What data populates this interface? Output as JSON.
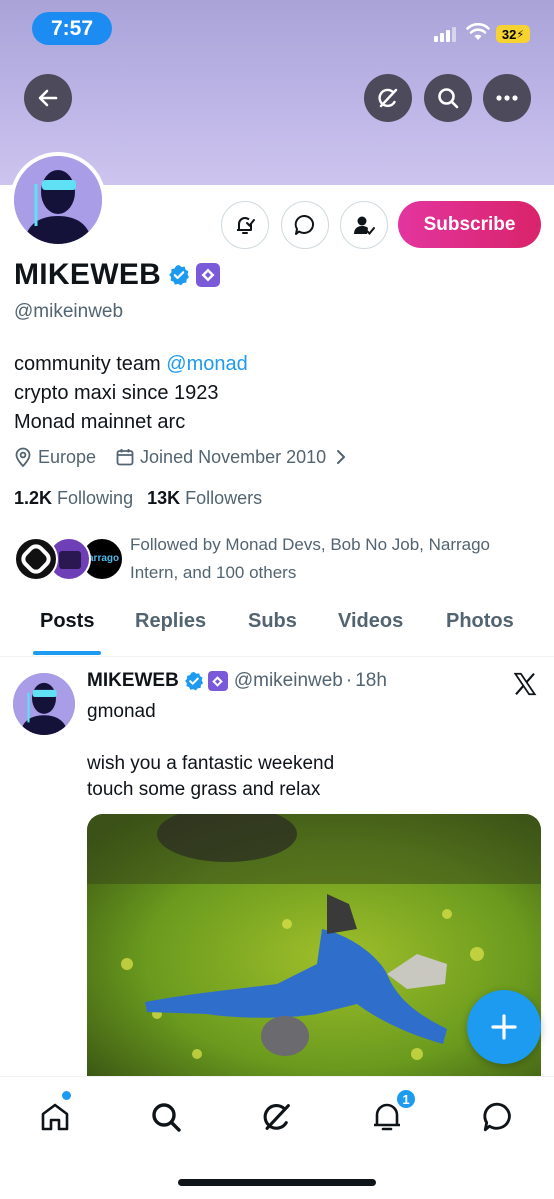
{
  "status_bar": {
    "time": "7:57",
    "battery": "32"
  },
  "profile": {
    "display_name": "MIKEWEB",
    "handle": "@mikeinweb",
    "subscribe_label": "Subscribe",
    "bio_line1_prefix": "community team ",
    "bio_mention": "@monad",
    "bio_line2": "crypto maxi since 1923",
    "bio_line3": "Monad mainnet arc",
    "location": "Europe",
    "joined": "Joined November 2010",
    "following_count": "1.2K",
    "following_label": "Following",
    "followers_count": "13K",
    "followers_label": "Followers",
    "followed_by": "Followed by Monad Devs, Bob No Job, Narrago Intern, and 100 others",
    "followed_avatar_3_text": "arrago"
  },
  "tabs": [
    {
      "label": "Posts",
      "active": true
    },
    {
      "label": "Replies"
    },
    {
      "label": "Subs"
    },
    {
      "label": "Videos"
    },
    {
      "label": "Photos"
    }
  ],
  "post": {
    "author": "MIKEWEB",
    "handle": "@mikeinweb",
    "separator": "·",
    "time": "18h",
    "line1": "gmonad",
    "line2": "wish you a fantastic weekend",
    "line3": "touch some grass and relax"
  },
  "bottom_nav": {
    "notification_count": "1"
  },
  "colors": {
    "accent": "#1d9bf0",
    "subscribe": "#e3359f",
    "banner": "#bdb5e6",
    "monad_purple": "#7b5ad9"
  },
  "icons": [
    "back-arrow-icon",
    "grok-icon",
    "search-icon",
    "more-icon",
    "notification-settings-icon",
    "message-icon",
    "follow-status-icon",
    "verified-badge-icon",
    "monad-badge-icon",
    "location-icon",
    "calendar-icon",
    "chevron-right-icon",
    "x-logo-icon",
    "plus-icon",
    "home-icon",
    "bell-icon",
    "chat-icon"
  ]
}
